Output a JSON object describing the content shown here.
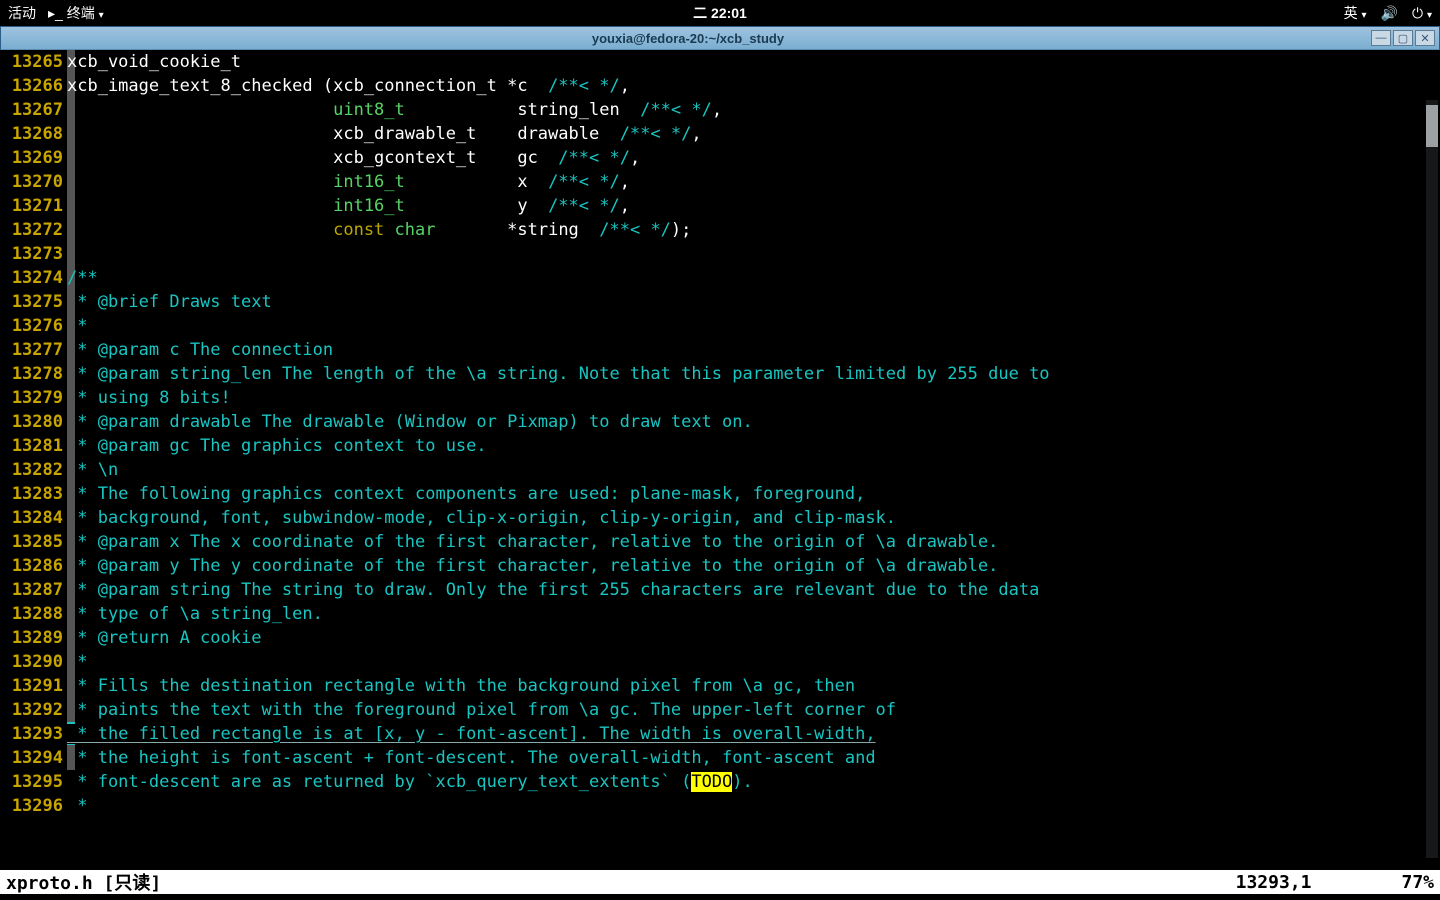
{
  "topbar": {
    "activities": "活动",
    "app": "终端",
    "clock": "二 22:01",
    "ime": "英"
  },
  "window": {
    "title": "youxia@fedora-20:~/xcb_study"
  },
  "gutter_start": 13265,
  "code_lines": [
    {
      "t": "code",
      "segs": [
        [
          "id",
          "xcb_void_cookie_t"
        ]
      ]
    },
    {
      "t": "code",
      "segs": [
        [
          "id",
          "xcb_image_text_8_checked ("
        ],
        [
          "id",
          "xcb_connection_t "
        ],
        [
          "id",
          "*c  "
        ],
        [
          "cmt",
          "/**< */"
        ],
        [
          "id",
          ","
        ]
      ]
    },
    {
      "t": "code",
      "segs": [
        [
          "id",
          "                          "
        ],
        [
          "type",
          "uint8_t"
        ],
        [
          "id",
          "           string_len  "
        ],
        [
          "cmt",
          "/**< */"
        ],
        [
          "id",
          ","
        ]
      ]
    },
    {
      "t": "code",
      "segs": [
        [
          "id",
          "                          xcb_drawable_t    drawable  "
        ],
        [
          "cmt",
          "/**< */"
        ],
        [
          "id",
          ","
        ]
      ]
    },
    {
      "t": "code",
      "segs": [
        [
          "id",
          "                          xcb_gcontext_t    gc  "
        ],
        [
          "cmt",
          "/**< */"
        ],
        [
          "id",
          ","
        ]
      ]
    },
    {
      "t": "code",
      "segs": [
        [
          "id",
          "                          "
        ],
        [
          "type",
          "int16_t"
        ],
        [
          "id",
          "           x  "
        ],
        [
          "cmt",
          "/**< */"
        ],
        [
          "id",
          ","
        ]
      ]
    },
    {
      "t": "code",
      "segs": [
        [
          "id",
          "                          "
        ],
        [
          "type",
          "int16_t"
        ],
        [
          "id",
          "           y  "
        ],
        [
          "cmt",
          "/**< */"
        ],
        [
          "id",
          ","
        ]
      ]
    },
    {
      "t": "code",
      "segs": [
        [
          "id",
          "                          "
        ],
        [
          "kw",
          "const"
        ],
        [
          "id",
          " "
        ],
        [
          "type",
          "char"
        ],
        [
          "id",
          "       *string  "
        ],
        [
          "cmt",
          "/**< */"
        ],
        [
          "id",
          ");"
        ]
      ]
    },
    {
      "t": "blank"
    },
    {
      "t": "cmt",
      "text": "/**"
    },
    {
      "t": "cmt",
      "text": " * @brief Draws text"
    },
    {
      "t": "cmt",
      "text": " *"
    },
    {
      "t": "cmt",
      "text": " * @param c The connection"
    },
    {
      "t": "cmt",
      "text": " * @param string_len The length of the \\a string. Note that this parameter limited by 255 due to"
    },
    {
      "t": "cmt",
      "text": " * using 8 bits!"
    },
    {
      "t": "cmt",
      "text": " * @param drawable The drawable (Window or Pixmap) to draw text on."
    },
    {
      "t": "cmt",
      "text": " * @param gc The graphics context to use."
    },
    {
      "t": "cmt",
      "text": " * \\n"
    },
    {
      "t": "cmt",
      "text": " * The following graphics context components are used: plane-mask, foreground,"
    },
    {
      "t": "cmt",
      "text": " * background, font, subwindow-mode, clip-x-origin, clip-y-origin, and clip-mask."
    },
    {
      "t": "cmt",
      "text": " * @param x The x coordinate of the first character, relative to the origin of \\a drawable."
    },
    {
      "t": "cmt",
      "text": " * @param y The y coordinate of the first character, relative to the origin of \\a drawable."
    },
    {
      "t": "cmt",
      "text": " * @param string The string to draw. Only the first 255 characters are relevant due to the data"
    },
    {
      "t": "cmt",
      "text": " * type of \\a string_len."
    },
    {
      "t": "cmt",
      "text": " * @return A cookie"
    },
    {
      "t": "cmt",
      "text": " *"
    },
    {
      "t": "cmt",
      "text": " * Fills the destination rectangle with the background pixel from \\a gc, then"
    },
    {
      "t": "cmt",
      "text": " * paints the text with the foreground pixel from \\a gc. The upper-left corner of"
    },
    {
      "t": "cur",
      "text": " * the filled rectangle is at [x, y - font-ascent]. The width is overall-width,"
    },
    {
      "t": "cmt",
      "text": " * the height is font-ascent + font-descent. The overall-width, font-ascent and"
    },
    {
      "t": "todo",
      "pre": " * font-descent are as returned by `xcb_query_text_extents` (",
      "todo": "TODO",
      "post": ")."
    },
    {
      "t": "cmt",
      "text": " *"
    }
  ],
  "status": {
    "file": "xproto.h",
    "readonly": "[只读]",
    "pos": "13293,1",
    "pct": "77%"
  }
}
